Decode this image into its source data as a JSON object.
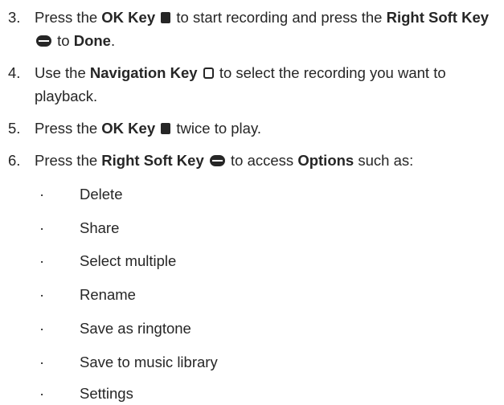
{
  "steps": [
    {
      "number": "3.",
      "press": "Press the",
      "ok_key": "OK Key",
      "to_start": "to start recording and press the",
      "right_soft_key": "Right Soft Key",
      "to": "to",
      "done": "Done",
      "period": "."
    },
    {
      "number": "4.",
      "use_the": "Use the",
      "navigation_key": "Navigation Key",
      "rest": "to select the recording you want to playback."
    },
    {
      "number": "5.",
      "press": "Press the",
      "ok_key": "OK Key",
      "rest": "twice to play."
    },
    {
      "number": "6.",
      "press": "Press the",
      "right_soft_key": "Right Soft Key",
      "to_access": "to access",
      "options": "Options",
      "such_as": "such as:"
    }
  ],
  "options_list": {
    "bullet": "·",
    "items": [
      "Delete",
      "Share",
      "Select multiple",
      "Rename",
      "Save as ringtone",
      "Save to music library",
      "Settings"
    ]
  },
  "icons": {
    "ok_key": "ok-key-icon",
    "right_soft_key": "right-soft-key-icon",
    "navigation_key": "navigation-key-icon"
  },
  "colors": {
    "text": "#262626",
    "background": "#ffffff"
  }
}
